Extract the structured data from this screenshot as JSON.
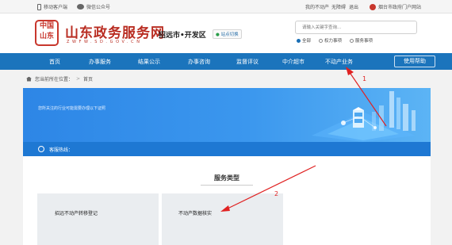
{
  "topbar": {
    "mobile_client": "移动客户端",
    "wechat_account": "微信公众号",
    "my_account": "我的不动产",
    "accessibility": "无障碍",
    "logout": "退出",
    "portal_link": "烟台市政府门户网站"
  },
  "header": {
    "seal_text": [
      "中",
      "国",
      "山",
      "东"
    ],
    "site_title": "山东政务服务网",
    "site_subtitle": "ZWFW.SD.GOV.CN",
    "region": "招远市•开发区",
    "switch_label": "站点切换",
    "search_placeholder": "请输入关键字查询...",
    "search_scopes": [
      {
        "label": "全部",
        "selected": true
      },
      {
        "label": "权力事项",
        "selected": false
      },
      {
        "label": "服务事项",
        "selected": false
      }
    ]
  },
  "nav": {
    "items": [
      "首页",
      "办事服务",
      "结果公示",
      "办事咨询",
      "监督评议",
      "中介超市",
      "不动产业务"
    ],
    "help_button": "使用帮助"
  },
  "breadcrumb": {
    "prefix": "您当前所在位置：",
    "current": "首页"
  },
  "banner": {
    "tagline": "您所关注的行业可能需要办理以下证照",
    "hotline_label": "客服热线："
  },
  "service": {
    "title": "服务类型",
    "cards": [
      "招远不动产转移登记",
      "不动产数据核实"
    ]
  },
  "annotations": {
    "labels": [
      "1",
      "2"
    ],
    "color": "#e02222"
  },
  "colors": {
    "nav_blue": "#1b74bc",
    "brand_red": "#b92d22",
    "banner_blue": "#2d86e6"
  }
}
